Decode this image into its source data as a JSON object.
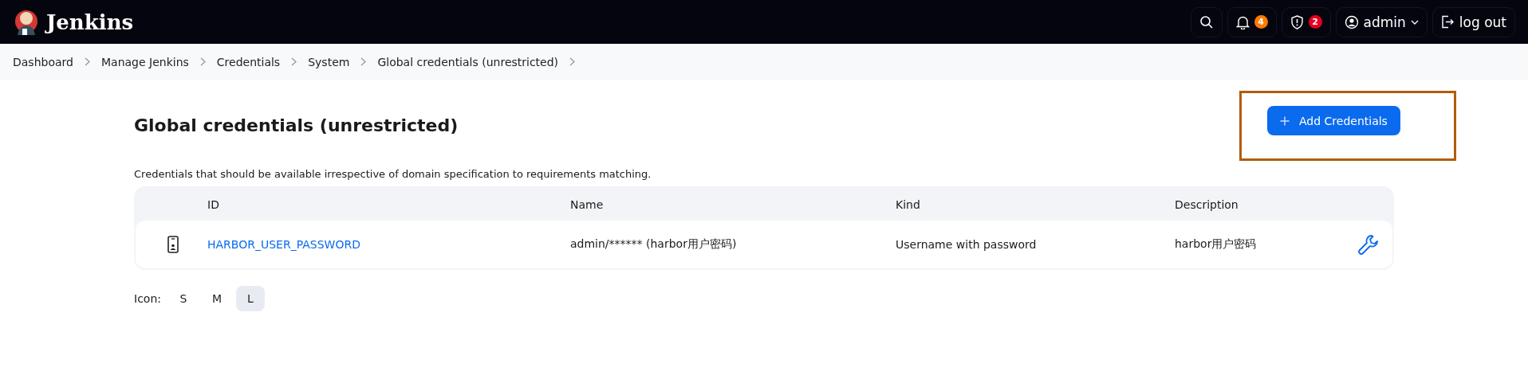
{
  "header": {
    "logo": "Jenkins",
    "notifications": "4",
    "security": "2",
    "user": "admin",
    "logout": "log out"
  },
  "breadcrumbs": [
    "Dashboard",
    "Manage Jenkins",
    "Credentials",
    "System",
    "Global credentials (unrestricted)"
  ],
  "page": {
    "title": "Global credentials (unrestricted)",
    "add_button": "Add Credentials",
    "description": "Credentials that should be available irrespective of domain specification to requirements matching."
  },
  "table": {
    "columns": [
      "ID",
      "Name",
      "Kind",
      "Description"
    ],
    "rows": [
      {
        "id": "HARBOR_USER_PASSWORD",
        "name": "admin/****** (harbor用户密码)",
        "kind": "Username with password",
        "description": "harbor用户密码"
      }
    ]
  },
  "icon_size": {
    "label": "Icon:",
    "options": [
      {
        "label": "S",
        "selected": false
      },
      {
        "label": "M",
        "selected": false
      },
      {
        "label": "L",
        "selected": true
      }
    ]
  }
}
